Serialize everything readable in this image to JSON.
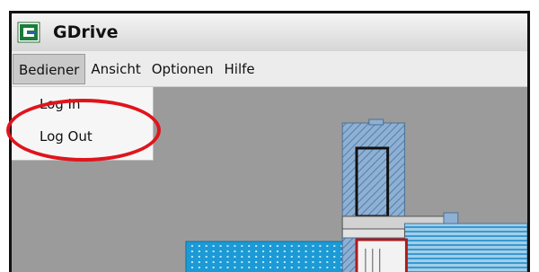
{
  "window": {
    "title": "GDrive",
    "icon": "gdrive-app-icon"
  },
  "menubar": {
    "items": [
      {
        "label": "Bediener",
        "active": true
      },
      {
        "label": "Ansicht",
        "active": false
      },
      {
        "label": "Optionen",
        "active": false
      },
      {
        "label": "Hilfe",
        "active": false
      }
    ]
  },
  "dropdown": {
    "items": [
      {
        "label": "Log In"
      },
      {
        "label": "Log Out"
      }
    ]
  },
  "colors": {
    "canvas_bg": "#9b9b9b",
    "hatch": "#5b87b5",
    "cyan_fill": "#1c9ad6",
    "annotation": "#e0141c"
  }
}
